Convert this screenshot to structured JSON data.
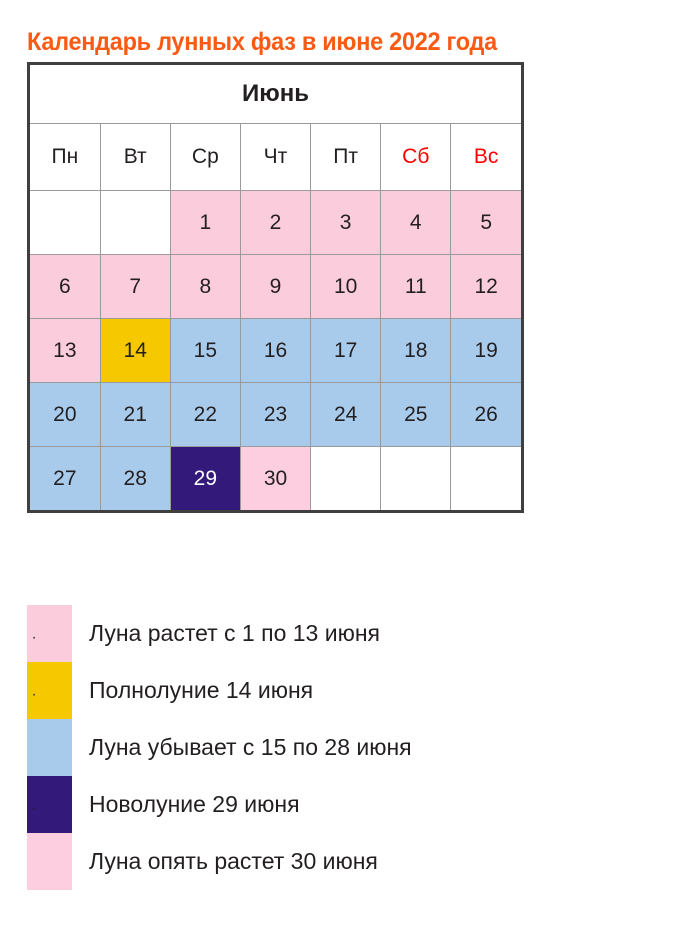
{
  "page": {
    "title": "Календарь лунных фаз в июне 2022 года",
    "title_color": "#fa5a14"
  },
  "calendar": {
    "month_label": "Июнь",
    "weekdays": [
      {
        "label": "Пн",
        "weekend": false
      },
      {
        "label": "Вт",
        "weekend": false
      },
      {
        "label": "Ср",
        "weekend": false
      },
      {
        "label": "Чт",
        "weekend": false
      },
      {
        "label": "Пт",
        "weekend": false
      },
      {
        "label": "Сб",
        "weekend": true
      },
      {
        "label": "Вс",
        "weekend": true
      }
    ],
    "weeks": [
      [
        {
          "day": "",
          "phase": "empty"
        },
        {
          "day": "",
          "phase": "empty"
        },
        {
          "day": "1",
          "phase": "waxing"
        },
        {
          "day": "2",
          "phase": "waxing"
        },
        {
          "day": "3",
          "phase": "waxing"
        },
        {
          "day": "4",
          "phase": "waxing"
        },
        {
          "day": "5",
          "phase": "waxing"
        }
      ],
      [
        {
          "day": "6",
          "phase": "waxing"
        },
        {
          "day": "7",
          "phase": "waxing"
        },
        {
          "day": "8",
          "phase": "waxing"
        },
        {
          "day": "9",
          "phase": "waxing"
        },
        {
          "day": "10",
          "phase": "waxing"
        },
        {
          "day": "11",
          "phase": "waxing"
        },
        {
          "day": "12",
          "phase": "waxing"
        }
      ],
      [
        {
          "day": "13",
          "phase": "waxing"
        },
        {
          "day": "14",
          "phase": "full"
        },
        {
          "day": "15",
          "phase": "waning"
        },
        {
          "day": "16",
          "phase": "waning"
        },
        {
          "day": "17",
          "phase": "waning"
        },
        {
          "day": "18",
          "phase": "waning"
        },
        {
          "day": "19",
          "phase": "waning"
        }
      ],
      [
        {
          "day": "20",
          "phase": "waning"
        },
        {
          "day": "21",
          "phase": "waning"
        },
        {
          "day": "22",
          "phase": "waning"
        },
        {
          "day": "23",
          "phase": "waning"
        },
        {
          "day": "24",
          "phase": "waning"
        },
        {
          "day": "25",
          "phase": "waning"
        },
        {
          "day": "26",
          "phase": "waning"
        }
      ],
      [
        {
          "day": "27",
          "phase": "waning"
        },
        {
          "day": "28",
          "phase": "waning"
        },
        {
          "day": "29",
          "phase": "new"
        },
        {
          "day": "30",
          "phase": "waxing2"
        },
        {
          "day": "",
          "phase": "empty"
        },
        {
          "day": "",
          "phase": "empty"
        },
        {
          "day": "",
          "phase": "empty"
        }
      ]
    ]
  },
  "legend": {
    "items": [
      {
        "label": "Луна растет с 1 по 13 июня",
        "phase": "waxing",
        "color": "#fbccdb",
        "dot": "."
      },
      {
        "label": "Полнолуние 14 июня",
        "phase": "full",
        "color": "#f5c800",
        "dot": "."
      },
      {
        "label": "Луна убывает с 15 по 28 июня",
        "phase": "waning",
        "color": "#a8cbec",
        "dot": ""
      },
      {
        "label": "Новолуние 29 июня",
        "phase": "new",
        "color": "#331a7a",
        "dot": "."
      },
      {
        "label": "Луна опять растет 30 июня",
        "phase": "waxing2",
        "color": "#fdcedf",
        "dot": ""
      }
    ]
  }
}
